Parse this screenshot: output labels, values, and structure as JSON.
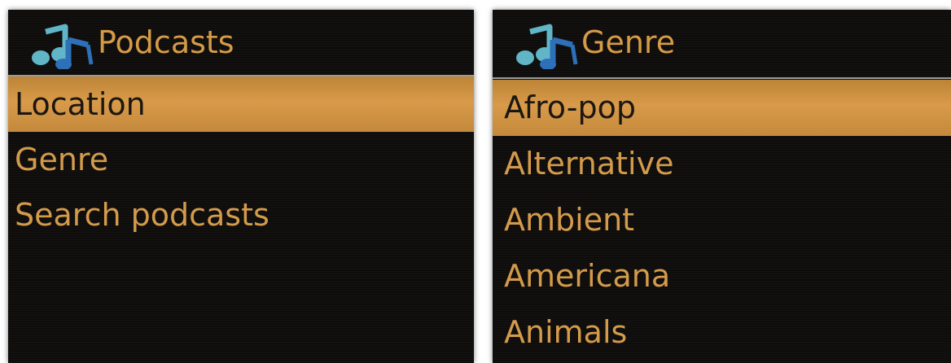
{
  "colors": {
    "screen_background": "#0e0d0c",
    "text_amber": "#d39a49",
    "highlight_bar": "#d89a48",
    "highlight_text": "#1a1511",
    "divider": "#9c9a95",
    "icon_note_light": "#5fb5c6",
    "icon_note_dark": "#2c6fb8"
  },
  "left_screen": {
    "title": "Podcasts",
    "icon": "music-notes-icon",
    "items": [
      {
        "label": "Location",
        "selected": true
      },
      {
        "label": "Genre",
        "selected": false
      },
      {
        "label": "Search podcasts",
        "selected": false
      }
    ]
  },
  "right_screen": {
    "title": "Genre",
    "icon": "music-notes-icon",
    "items": [
      {
        "label": "Afro-pop",
        "selected": true
      },
      {
        "label": "Alternative",
        "selected": false
      },
      {
        "label": "Ambient",
        "selected": false
      },
      {
        "label": "Americana",
        "selected": false
      },
      {
        "label": "Animals",
        "selected": false
      }
    ]
  }
}
